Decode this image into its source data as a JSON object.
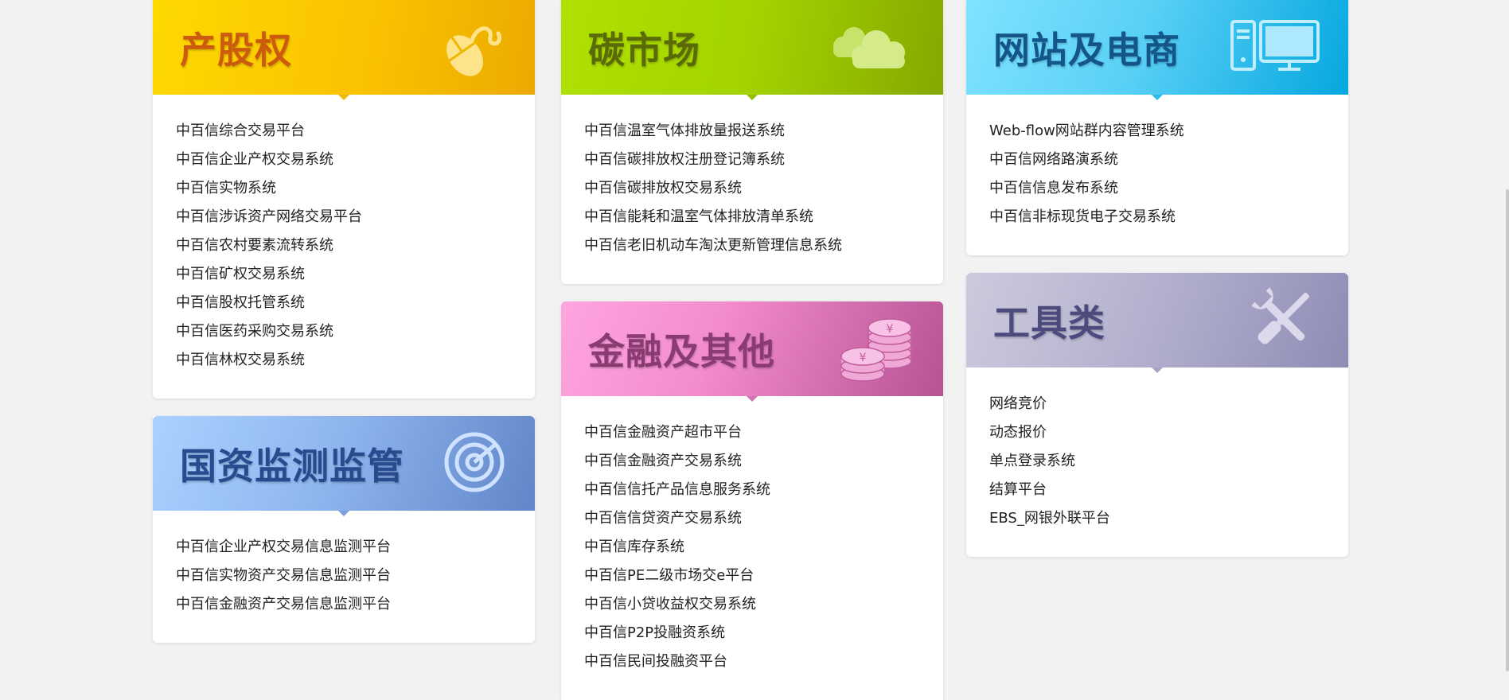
{
  "cards": {
    "property": {
      "title": "产股权",
      "icon": "mouse-icon",
      "items": [
        "中百信综合交易平台",
        "中百信企业产权交易系统",
        "中百信实物系统",
        "中百信涉诉资产网络交易平台",
        "中百信农村要素流转系统",
        "中百信矿权交易系统",
        "中百信股权托管系统",
        "中百信医药采购交易系统",
        "中百信林权交易系统"
      ]
    },
    "carbon": {
      "title": "碳市场",
      "icon": "cloud-icon",
      "items": [
        "中百信温室气体排放量报送系统",
        "中百信碳排放权注册登记簿系统",
        "中百信碳排放权交易系统",
        "中百信能耗和温室气体排放清单系统",
        "中百信老旧机动车淘汰更新管理信息系统"
      ]
    },
    "web": {
      "title": "网站及电商",
      "icon": "computer-icon",
      "items": [
        "Web-flow网站群内容管理系统",
        "中百信网络路演系统",
        "中百信信息发布系统",
        "中百信非标现货电子交易系统"
      ]
    },
    "monitor": {
      "title": "国资监测监管",
      "icon": "target-icon",
      "items": [
        "中百信企业产权交易信息监测平台",
        "中百信实物资产交易信息监测平台",
        "中百信金融资产交易信息监测平台"
      ]
    },
    "finance": {
      "title": "金融及其他",
      "icon": "coins-icon",
      "coin_symbol": "¥",
      "items": [
        "中百信金融资产超市平台",
        "中百信金融资产交易系统",
        "中百信信托产品信息服务系统",
        "中百信信贷资产交易系统",
        "中百信库存系统",
        "中百信PE二级市场交e平台",
        "中百信小贷收益权交易系统",
        "中百信P2P投融资系统",
        "中百信民间投融资平台"
      ]
    },
    "tools": {
      "title": "工具类",
      "icon": "tools-icon",
      "items": [
        "网络竞价",
        "动态报价",
        "单点登录系统",
        "结算平台",
        "EBS_网银外联平台"
      ]
    }
  }
}
